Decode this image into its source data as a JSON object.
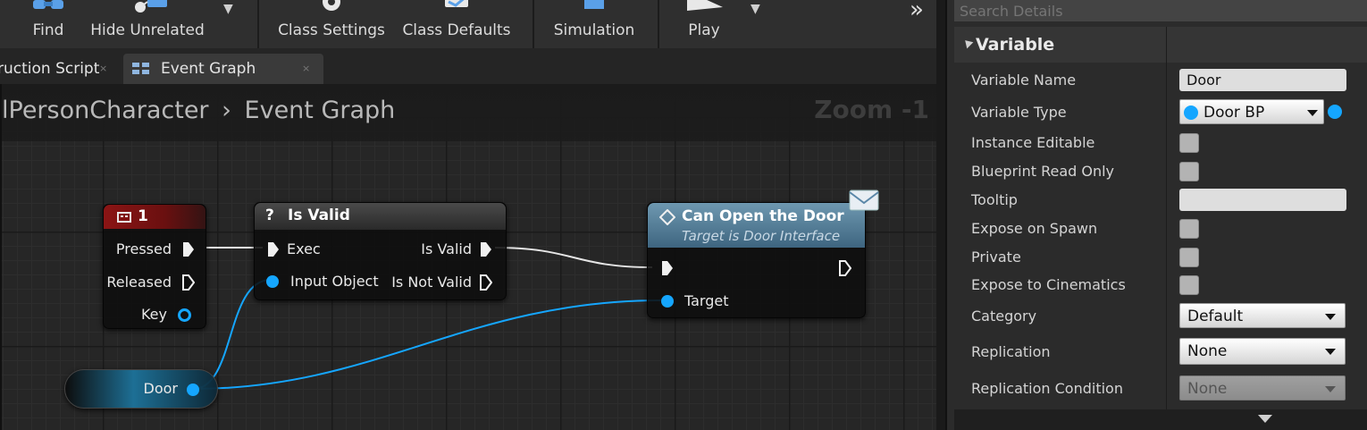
{
  "toolbar": {
    "buttons": [
      {
        "label": "Find",
        "icon": "binoculars-icon"
      },
      {
        "label": "Hide Unrelated",
        "icon": "hide-unrelated-icon"
      },
      {
        "label": "Class Settings",
        "icon": "gear-icon"
      },
      {
        "label": "Class Defaults",
        "icon": "class-defaults-icon"
      },
      {
        "label": "Simulation",
        "icon": "simulation-icon"
      },
      {
        "label": "Play",
        "icon": "play-icon"
      }
    ],
    "overflow": "»"
  },
  "tabs": [
    {
      "label": "ruction Script",
      "close": "×"
    },
    {
      "label": "Event Graph",
      "close": "×",
      "active": true
    }
  ],
  "breadcrumb": {
    "parent": "lPersonCharacter",
    "separator": "›",
    "current": "Event Graph"
  },
  "zoom": "Zoom -1",
  "nodes": {
    "key_event": {
      "title": "1",
      "pins": [
        "Pressed",
        "Released",
        "Key"
      ],
      "header_color": "#8b1414"
    },
    "is_valid": {
      "title": "Is Valid",
      "icon": "?",
      "inputs": [
        "Exec",
        "Input Object"
      ],
      "outputs": [
        "Is Valid",
        "Is Not Valid"
      ]
    },
    "can_open": {
      "title": "Can Open the Door",
      "subtitle": "Target is Door Interface",
      "inputs": [
        "Target"
      ],
      "header_color": "#4f7892"
    },
    "door_var": {
      "label": "Door"
    }
  },
  "pin_color": "#15a6ff",
  "details": {
    "search_placeholder": "Search Details",
    "category": "Variable",
    "props": [
      {
        "label": "Variable Name",
        "value": "Door"
      },
      {
        "label": "Variable Type",
        "value": "Door BP"
      },
      {
        "label": "Instance Editable"
      },
      {
        "label": "Blueprint Read Only"
      },
      {
        "label": "Tooltip",
        "value": ""
      },
      {
        "label": "Expose on Spawn"
      },
      {
        "label": "Private"
      },
      {
        "label": "Expose to Cinematics"
      },
      {
        "label": "Category",
        "value": "Default"
      },
      {
        "label": "Replication",
        "value": "None"
      },
      {
        "label": "Replication Condition",
        "value": "None"
      }
    ]
  }
}
